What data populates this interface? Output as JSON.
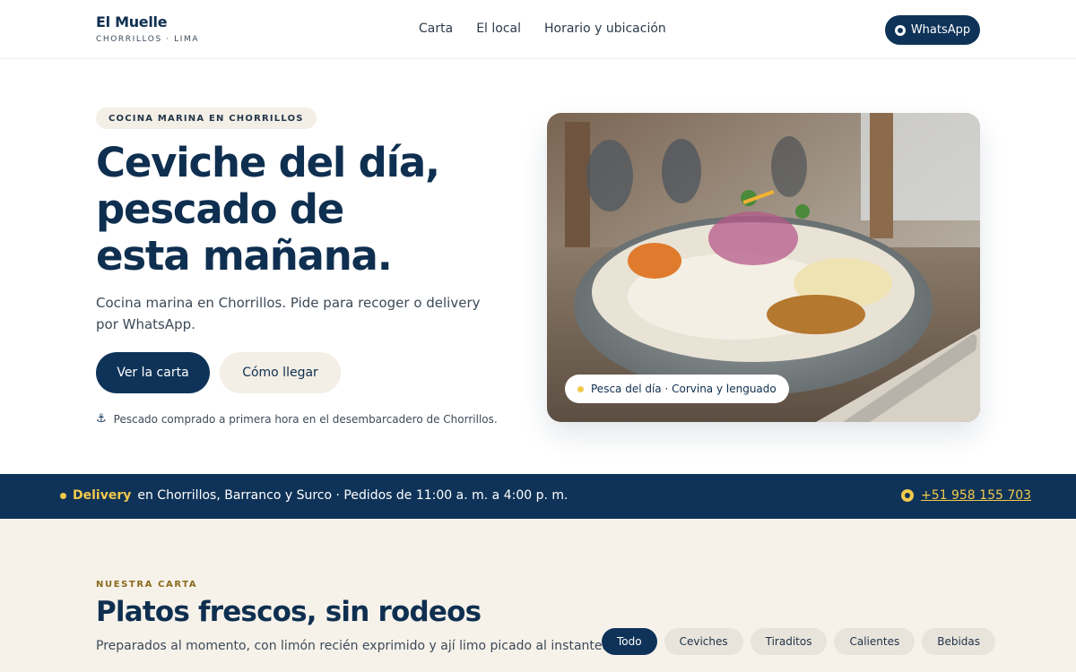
{
  "header": {
    "brand_name": "El Muelle",
    "brand_sub": "CHORRILLOS · LIMA",
    "nav": [
      "Carta",
      "El local",
      "Horario y ubicación"
    ],
    "whatsapp_label": "WhatsApp"
  },
  "hero": {
    "badge": "COCINA MARINA EN CHORRILLOS",
    "title_line1": "Ceviche del día,",
    "title_line2": "pescado de",
    "title_line3": "esta mañana.",
    "description": "Cocina marina en Chorrillos. Pide para recoger o delivery por WhatsApp.",
    "primary_button": "Ver la carta",
    "secondary_button": "Cómo llegar",
    "note": "Pescado comprado a primera hora en el desembarcadero de Chorrillos.",
    "image_pill": "Pesca del día · Corvina y lenguado"
  },
  "banner": {
    "highlight": "Delivery",
    "text": "en Chorrillos, Barranco y Surco · Pedidos de 11:00 a. m. a 4:00 p. m.",
    "phone": "+51 958 155 703"
  },
  "menu": {
    "kicker": "NUESTRA CARTA",
    "title": "Platos frescos, sin rodeos",
    "description": "Preparados al momento, con limón recién exprimido y ají limo picado al instante.",
    "filters": [
      "Todo",
      "Ceviches",
      "Tiraditos",
      "Calientes",
      "Bebidas"
    ],
    "active_filter": "Todo"
  },
  "colors": {
    "navy": "#0f3358",
    "accent_yellow": "#f2c94c",
    "cream": "#f6f2ea"
  }
}
